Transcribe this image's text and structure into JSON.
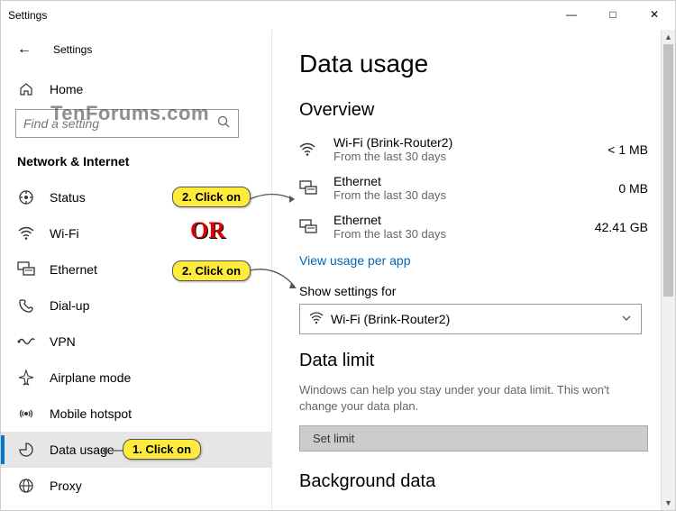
{
  "window": {
    "title": "Settings"
  },
  "winControls": {
    "min": "—",
    "max": "□",
    "close": "✕"
  },
  "sidebar": {
    "back": "←",
    "settings": "Settings",
    "home": "Home",
    "searchPlaceholder": "Find a setting",
    "section": "Network & Internet",
    "items": [
      {
        "icon": "status",
        "label": "Status"
      },
      {
        "icon": "wifi",
        "label": "Wi-Fi"
      },
      {
        "icon": "ethernet",
        "label": "Ethernet"
      },
      {
        "icon": "dialup",
        "label": "Dial-up"
      },
      {
        "icon": "vpn",
        "label": "VPN"
      },
      {
        "icon": "airplane",
        "label": "Airplane mode"
      },
      {
        "icon": "hotspot",
        "label": "Mobile hotspot"
      },
      {
        "icon": "datausage",
        "label": "Data usage",
        "active": true
      },
      {
        "icon": "proxy",
        "label": "Proxy"
      }
    ]
  },
  "page": {
    "title": "Data usage",
    "overview": "Overview",
    "nets": [
      {
        "name": "Wi-Fi (Brink-Router2)",
        "sub": "From the last 30 days",
        "val": "< 1 MB",
        "icon": "wifi"
      },
      {
        "name": "Ethernet",
        "sub": "From the last 30 days",
        "val": "0 MB",
        "icon": "ethernet"
      },
      {
        "name": "Ethernet",
        "sub": "From the last 30 days",
        "val": "42.41 GB",
        "icon": "ethernet"
      }
    ],
    "viewLink": "View usage per app",
    "showLabel": "Show settings for",
    "dropdown": {
      "icon": "wifi",
      "text": "Wi-Fi (Brink-Router2)"
    },
    "limitHdr": "Data limit",
    "limitDesc": "Windows can help you stay under your data limit. This won't change your data plan.",
    "setLimit": "Set limit",
    "bgHdr": "Background data"
  },
  "annotations": {
    "c1": "1. Click on",
    "c2a": "2. Click on",
    "c2b": "2. Click on",
    "or": "OR",
    "watermark": "TenForums.com"
  }
}
